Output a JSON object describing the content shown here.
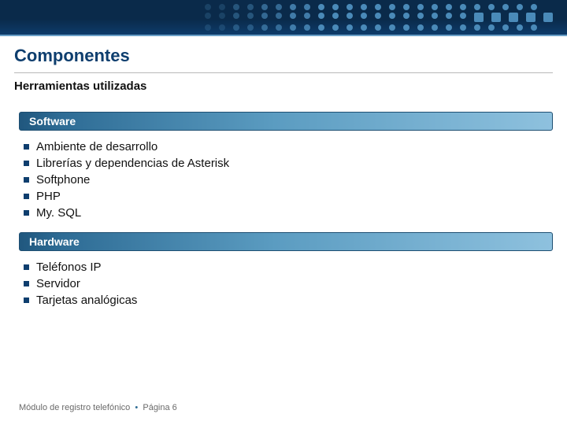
{
  "header": {
    "title": "Componentes",
    "subtitle": "Herramientas utilizadas"
  },
  "sections": {
    "software": {
      "heading": "Software",
      "items": [
        "Ambiente de desarrollo",
        "Librerías y dependencias de Asterisk",
        "Softphone",
        "PHP",
        "My. SQL"
      ]
    },
    "hardware": {
      "heading": "Hardware",
      "items": [
        "Teléfonos IP",
        "Servidor",
        "Tarjetas analógicas"
      ]
    }
  },
  "footer": {
    "module": "Módulo de registro telefónico",
    "separator": "•",
    "page_label": "Página 6"
  }
}
